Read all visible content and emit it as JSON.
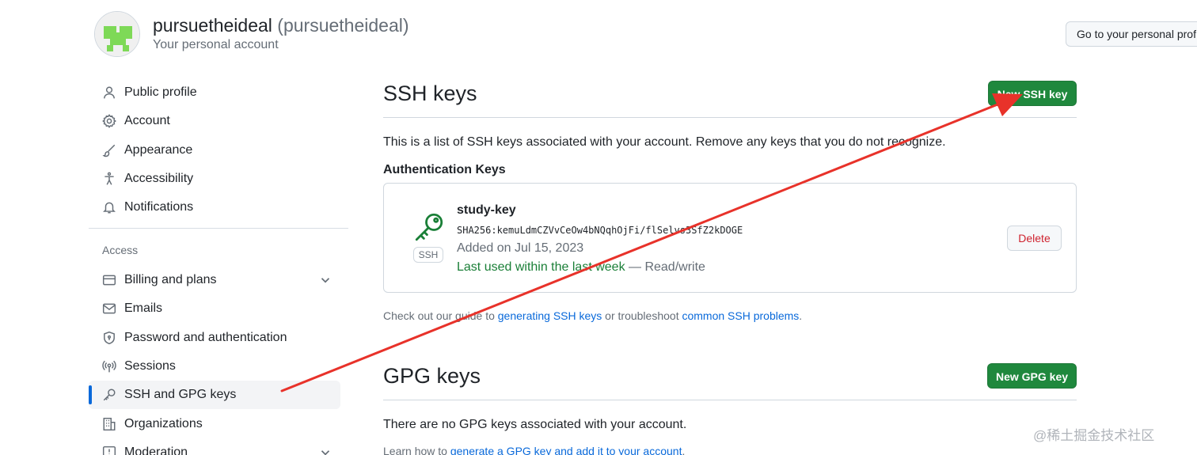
{
  "header": {
    "username": "pursuetheideal",
    "login": "(pursuetheideal)",
    "subtitle": "Your personal account",
    "goto_button": "Go to your personal prof"
  },
  "sidebar": {
    "items": [
      {
        "label": "Public profile",
        "icon": "person-icon"
      },
      {
        "label": "Account",
        "icon": "gear-icon"
      },
      {
        "label": "Appearance",
        "icon": "paintbrush-icon"
      },
      {
        "label": "Accessibility",
        "icon": "accessibility-icon"
      },
      {
        "label": "Notifications",
        "icon": "bell-icon"
      }
    ],
    "access_heading": "Access",
    "access_items": [
      {
        "label": "Billing and plans",
        "icon": "credit-card-icon",
        "expandable": true
      },
      {
        "label": "Emails",
        "icon": "mail-icon"
      },
      {
        "label": "Password and authentication",
        "icon": "shield-lock-icon"
      },
      {
        "label": "Sessions",
        "icon": "broadcast-icon"
      },
      {
        "label": "SSH and GPG keys",
        "icon": "key-icon",
        "active": true
      },
      {
        "label": "Organizations",
        "icon": "organization-icon"
      },
      {
        "label": "Moderation",
        "icon": "report-icon",
        "expandable": true
      }
    ]
  },
  "ssh": {
    "title": "SSH keys",
    "new_button": "New SSH key",
    "description": "This is a list of SSH keys associated with your account. Remove any keys that you do not recognize.",
    "auth_heading": "Authentication Keys",
    "key": {
      "name": "study-key",
      "fingerprint": "SHA256:kemuLdmCZVvCeOw4bNQqhOjFi/flSelvs3SfZ2kDOGE",
      "added": "Added on Jul 15, 2023",
      "last_used": "Last used within the last week",
      "access": " — Read/write",
      "type_label": "SSH",
      "delete_button": "Delete"
    },
    "guide_prefix": "Check out our guide to ",
    "guide_link1": "generating SSH keys",
    "guide_middle": " or troubleshoot ",
    "guide_link2": "common SSH problems",
    "guide_suffix": "."
  },
  "gpg": {
    "title": "GPG keys",
    "new_button": "New GPG key",
    "empty_text": "There are no GPG keys associated with your account.",
    "learn_prefix": "Learn how to ",
    "learn_link": "generate a GPG key and add it to your account",
    "learn_suffix": "."
  },
  "watermark": "@稀土掘金技术社区",
  "colors": {
    "accent": "#0969da",
    "primary_button": "#1f883d",
    "success": "#1a7f37",
    "danger": "#cf222e",
    "annotation_arrow": "#e8322a"
  }
}
